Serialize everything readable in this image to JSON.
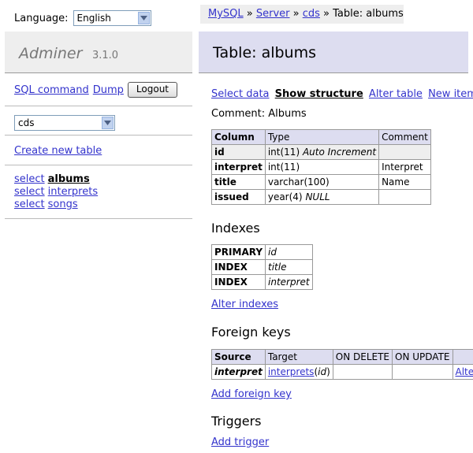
{
  "language": {
    "label": "Language:",
    "selected": "English"
  },
  "breadcrumb": {
    "mysql": "MySQL",
    "sep1": " » ",
    "server": "Server",
    "sep2": " » ",
    "db": "cds",
    "sep3": " » ",
    "current": "Table: albums"
  },
  "app": {
    "name": "Adminer",
    "version": "3.1.0"
  },
  "page_title": "Table: albums",
  "sidebar": {
    "sql_command": "SQL command",
    "dump": "Dump",
    "logout": "Logout",
    "db_selected": "cds",
    "create_table": "Create new table",
    "tables": [
      {
        "select": "select",
        "name": "albums"
      },
      {
        "select": "select",
        "name": "interprets"
      },
      {
        "select": "select",
        "name": "songs"
      }
    ]
  },
  "actions": {
    "select_data": "Select data",
    "show_structure": "Show structure",
    "alter_table": "Alter table",
    "new_item": "New item"
  },
  "comment": {
    "label": "Comment:",
    "value": "Albums"
  },
  "columns": {
    "headers": [
      "Column",
      "Type",
      "Comment"
    ],
    "rows": [
      {
        "name": "id",
        "type": "int(11)",
        "extra": "Auto Increment",
        "comment": ""
      },
      {
        "name": "interpret",
        "type": "int(11)",
        "extra": "",
        "comment": "Interpret"
      },
      {
        "name": "title",
        "type": "varchar(100)",
        "extra": "",
        "comment": "Name"
      },
      {
        "name": "issued",
        "type": "year(4)",
        "extra": "NULL",
        "comment": ""
      }
    ]
  },
  "indexes": {
    "title": "Indexes",
    "rows": [
      {
        "type": "PRIMARY",
        "column": "id"
      },
      {
        "type": "INDEX",
        "column": "title"
      },
      {
        "type": "INDEX",
        "column": "interpret"
      }
    ],
    "alter_link": "Alter indexes"
  },
  "foreign_keys": {
    "title": "Foreign keys",
    "headers": [
      "Source",
      "Target",
      "ON DELETE",
      "ON UPDATE"
    ],
    "rows": [
      {
        "source": "interpret",
        "target_table": "interprets",
        "target_col": "id",
        "on_delete": "",
        "on_update": "",
        "alter": "Alter"
      }
    ],
    "add_link": "Add foreign key"
  },
  "triggers": {
    "title": "Triggers",
    "add_link": "Add trigger"
  },
  "colors": {
    "link": "#3333cc",
    "header_bg": "#ddddf0",
    "panel_bg": "#eeeeee"
  }
}
